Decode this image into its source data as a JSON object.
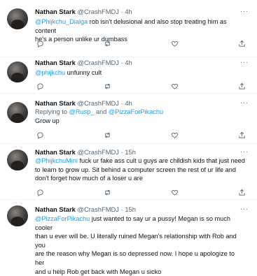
{
  "tweets": [
    {
      "name": "Nathan Stark",
      "handle": "@CrashFMDJ",
      "dot": "·",
      "time": "4h",
      "more": "···",
      "mention": "@Phijkchu_Dialga",
      "text_line1": " rob isn't delusional and also stop treating him as content",
      "text_line2": "he's a person unlike ur dumbass"
    },
    {
      "name": "Nathan Stark",
      "handle": "@CrashFMDJ",
      "dot": "·",
      "time": "4h",
      "more": "···",
      "mention": "@phijkchu",
      "text": " unfunny cult"
    },
    {
      "name": "Nathan Stark",
      "handle": "@CrashFMDJ",
      "dot": "·",
      "time": "4h",
      "more": "···",
      "replying_prefix": "Replying to ",
      "replying_mention1": "@Rusp_",
      "replying_and": " and ",
      "replying_mention2": "@PizzaForPikachu",
      "text": "Grow up"
    },
    {
      "name": "Nathan Stark",
      "handle": "@CrashFMDJ",
      "dot": "·",
      "time": "15h",
      "more": "···",
      "mention": "@PhijkchuMini",
      "text_line1": " fuck ur fake ass cult u guys are childish kids that just need",
      "text_line2": "to learn to grow up. Sit behind a computer screen the rest of ur life and",
      "text_line3": "don't forget how much of a loser u are"
    },
    {
      "name": "Nathan Stark",
      "handle": "@CrashFMDJ",
      "dot": "·",
      "time": "15h",
      "more": "···",
      "mention": "@PizzaForPikachu",
      "text_line1": " just wanted to say ur a pussy! Megan is so much cooler",
      "text_line2": "than u ever will be. U literally ruined Megan's relationship with Rob and you",
      "text_line3": "are the reason why Megan is so depressed now. I hope u apologize to her",
      "text_line4": "and u help Rob get back with Megan u sicko"
    }
  ],
  "icons": {
    "reply": "reply-icon",
    "retweet": "retweet-icon",
    "like": "like-icon",
    "share": "share-icon"
  },
  "colors": {
    "link": "#1d9bf0",
    "secondary": "#536471",
    "text": "#0f1419"
  }
}
